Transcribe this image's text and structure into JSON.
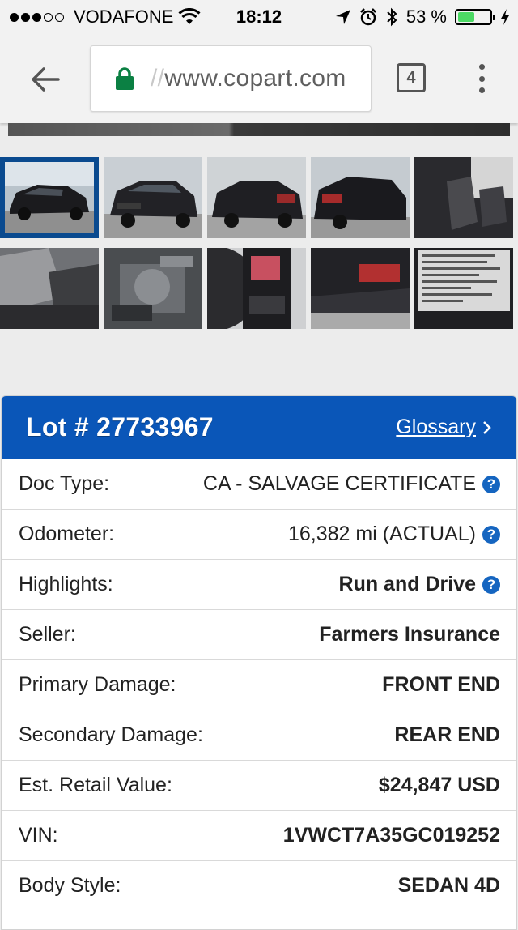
{
  "status_bar": {
    "signal_bars_filled": 3,
    "signal_bars_total": 5,
    "carrier": "VODAFONE",
    "time": "18:12",
    "battery_percent": "53 %",
    "battery_level": 0.53
  },
  "browser": {
    "url_prefix": "//",
    "url": "www.copart.com",
    "tab_count": "4",
    "icons": [
      "back-arrow-icon",
      "lock-icon",
      "tabs-icon",
      "overflow-menu-icon"
    ]
  },
  "gallery": {
    "thumbnails": [
      {
        "label": "front-left exterior"
      },
      {
        "label": "front-right exterior"
      },
      {
        "label": "rear-left exterior"
      },
      {
        "label": "rear-right exterior"
      },
      {
        "label": "front interior seats"
      },
      {
        "label": "rear interior seats"
      },
      {
        "label": "engine bay"
      },
      {
        "label": "instrument cluster"
      },
      {
        "label": "rear damage close-up"
      },
      {
        "label": "vin sticker"
      }
    ],
    "selected_index": 0
  },
  "lot": {
    "title": "Lot # 27733967",
    "glossary_label": "Glossary",
    "rows": [
      {
        "label": "Doc Type:",
        "value": "CA - SALVAGE CERTIFICATE",
        "help": true,
        "bold": false
      },
      {
        "label": "Odometer:",
        "value": "16,382 mi (ACTUAL)",
        "help": true,
        "bold": false
      },
      {
        "label": "Highlights:",
        "value": "Run and Drive",
        "help": true,
        "bold": true
      },
      {
        "label": "Seller:",
        "value": "Farmers Insurance",
        "help": false,
        "bold": true
      },
      {
        "label": "Primary Damage:",
        "value": "FRONT END",
        "help": false,
        "bold": true
      },
      {
        "label": "Secondary Damage:",
        "value": "REAR END",
        "help": false,
        "bold": true
      },
      {
        "label": "Est. Retail Value:",
        "value": "$24,847 USD",
        "help": false,
        "bold": true
      },
      {
        "label": "VIN:",
        "value": "1VWCT7A35GC019252",
        "help": false,
        "bold": true
      },
      {
        "label": "Body Style:",
        "value": "SEDAN 4D",
        "help": false,
        "bold": true
      }
    ]
  },
  "colors": {
    "header_blue": "#0a56b8",
    "help_blue": "#1565c0",
    "selected_border": "#0a4a8f",
    "battery_green": "#4cd964"
  }
}
